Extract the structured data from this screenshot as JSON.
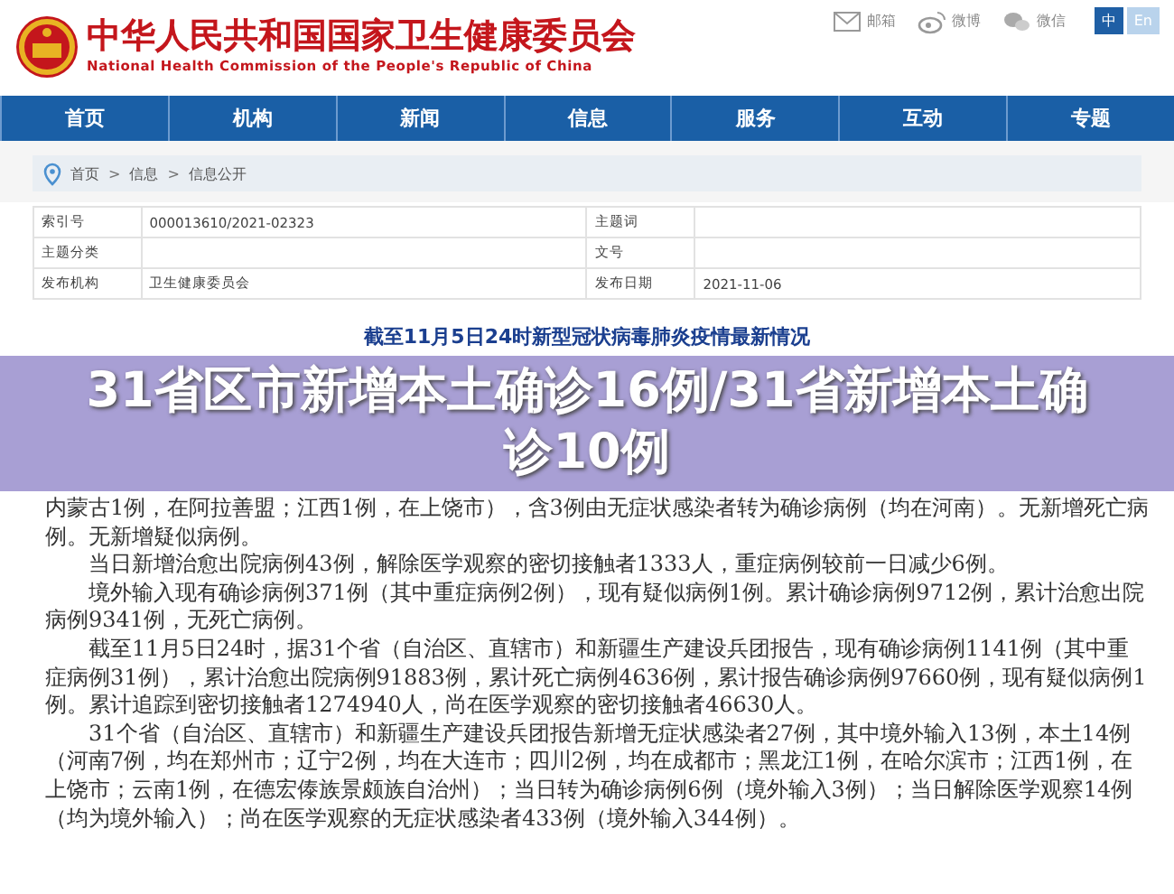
{
  "header": {
    "title": "中华人民共和国国家卫生健康委员会",
    "subtitle": "National Health Commission of the People's Republic of China",
    "links": [
      {
        "kind": "mail",
        "label": "邮箱"
      },
      {
        "kind": "weibo",
        "label": "微博"
      },
      {
        "kind": "wechat",
        "label": "微信"
      }
    ],
    "languages": [
      {
        "label": "中",
        "selected": true
      },
      {
        "label": "En",
        "selected": false
      }
    ]
  },
  "nav": {
    "items": [
      "首页",
      "机构",
      "新闻",
      "信息",
      "服务",
      "互动",
      "专题"
    ]
  },
  "breadcrumb": {
    "separator": ">",
    "items": [
      "首页",
      "信息",
      "信息公开"
    ]
  },
  "meta_table": {
    "rows": [
      [
        {
          "label": "索引号",
          "value": "000013610/2021-02323"
        },
        {
          "label": "主题词"
        }
      ],
      [
        {
          "label": "主题分类"
        },
        {
          "label": "文号"
        }
      ],
      [
        {
          "label": "发布机构",
          "value": "卫生健康委员会"
        },
        {
          "label": "发布日期",
          "value": "2021-11-06"
        }
      ]
    ]
  },
  "article": {
    "title": "截至11月5日24时新型冠状病毒肺炎疫情最新情况",
    "paragraphs": [
      {
        "indent": false,
        "text": "内蒙古1例，在阿拉善盟；江西1例，在上饶市），含3例由无症状感染者转为确诊病例（均在河南）。无新增死亡病例。无新增疑似病例。"
      },
      {
        "indent": true,
        "text": "当日新增治愈出院病例43例，解除医学观察的密切接触者1333人，重症病例较前一日减少6例。"
      },
      {
        "indent": true,
        "text": "境外输入现有确诊病例371例（其中重症病例2例），现有疑似病例1例。累计确诊病例9712例，累计治愈出院病例9341例，无死亡病例。"
      },
      {
        "indent": true,
        "text": "截至11月5日24时，据31个省（自治区、直辖市）和新疆生产建设兵团报告，现有确诊病例1141例（其中重症病例31例），累计治愈出院病例91883例，累计死亡病例4636例，累计报告确诊病例97660例，现有疑似病例1例。累计追踪到密切接触者1274940人，尚在医学观察的密切接触者46630人。"
      },
      {
        "indent": true,
        "text": "31个省（自治区、直辖市）和新疆生产建设兵团报告新增无症状感染者27例，其中境外输入13例，本土14例（河南7例，均在郑州市；辽宁2例，均在大连市；四川2例，均在成都市；黑龙江1例，在哈尔滨市；江西1例，在上饶市；云南1例，在德宏傣族景颇族自治州）；当日转为确诊病例6例（境外输入3例）；当日解除医学观察14例（均为境外输入）；尚在医学观察的无症状感染者433例（境外输入344例）。"
      }
    ]
  },
  "banner": {
    "headline": "31省区市新增本土确诊16例/31省新增本土确诊10例"
  }
}
